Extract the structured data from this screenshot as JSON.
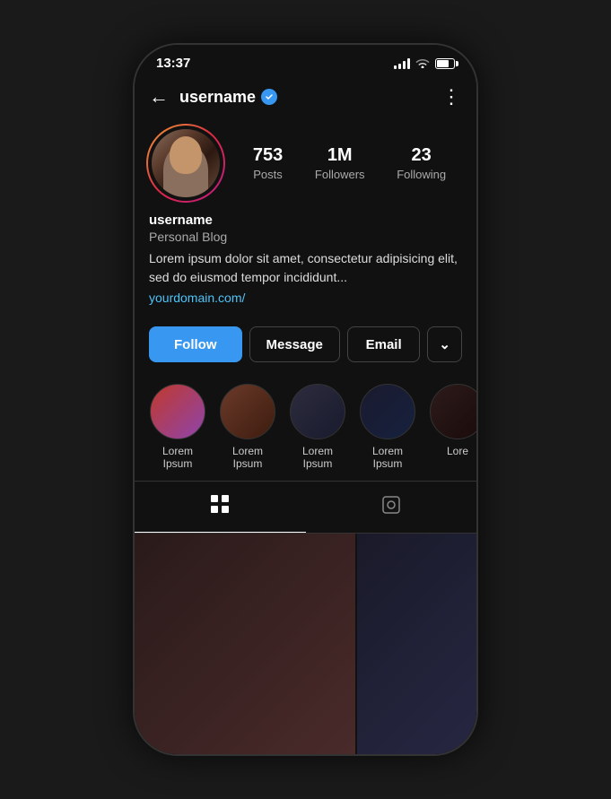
{
  "status": {
    "time": "13:37",
    "signal": "signal-icon",
    "wifi": "wifi-icon",
    "battery": "battery-icon"
  },
  "header": {
    "back_label": "←",
    "username": "username",
    "more_label": "⋮"
  },
  "profile": {
    "name": "username",
    "bio_title": "Personal Blog",
    "bio_text": "Lorem ipsum dolor sit amet, consectetur adipisicing elit, sed do eiusmod tempor incididunt...",
    "link": "yourdomain.com/",
    "stats": {
      "posts_count": "753",
      "posts_label": "Posts",
      "followers_count": "1M",
      "followers_label": "Followers",
      "following_count": "23",
      "following_label": "Following"
    }
  },
  "actions": {
    "follow_label": "Follow",
    "message_label": "Message",
    "email_label": "Email",
    "more_label": "⌄"
  },
  "highlights": [
    {
      "label": "Lorem Ipsum"
    },
    {
      "label": "Lorem Ipsum"
    },
    {
      "label": "Lorem Ipsum"
    },
    {
      "label": "Lorem Ipsum"
    },
    {
      "label": "Lore"
    }
  ],
  "tabs": {
    "grid_icon": "▦",
    "tag_icon": "⊡"
  }
}
